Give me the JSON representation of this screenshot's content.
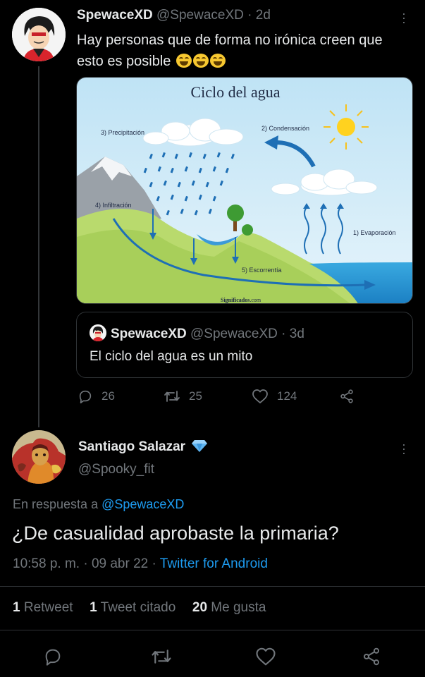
{
  "tweet": {
    "display_name": "SpewaceXD",
    "handle": "@SpewaceXD",
    "separator": "·",
    "age": "2d",
    "text": "Hay personas que de forma no irónica creen que esto es posible",
    "emojis": [
      "laughing-cat",
      "laughing-cat",
      "laughing-cat"
    ],
    "media": {
      "title": "Ciclo del agua",
      "labels": {
        "precipitation": "3) Precipitación",
        "condensation": "2) Condensación",
        "infiltration": "4) Infiltración",
        "evaporation": "1) Evaporación",
        "runoff": "5) Escorrentía"
      },
      "credit": "Significados",
      "credit_suffix": ".com"
    },
    "quoted": {
      "display_name": "SpewaceXD",
      "handle": "@SpewaceXD",
      "separator": "·",
      "age": "3d",
      "text": "El ciclo del agua es un mito"
    },
    "actions": {
      "replies": "26",
      "retweets": "25",
      "likes": "124"
    }
  },
  "reply": {
    "display_name": "Santiago Salazar",
    "handle": "@Spooky_fit",
    "in_reply_prefix": "En respuesta a",
    "in_reply_to": "@SpewaceXD",
    "text": "¿De casualidad aprobaste la primaria?",
    "time": "10:58 p. m.",
    "date": "09 abr 22",
    "client": "Twitter for Android",
    "separator": "·",
    "stats": {
      "retweets_count": "1",
      "retweets_label": "Retweet",
      "quotes_count": "1",
      "quotes_label": "Tweet citado",
      "likes_count": "20",
      "likes_label": "Me gusta"
    }
  },
  "colors": {
    "background": "#000000",
    "text": "#e7e9ea",
    "muted": "#71767b",
    "link": "#1d9bf0",
    "verified": "#5fb4f0"
  }
}
